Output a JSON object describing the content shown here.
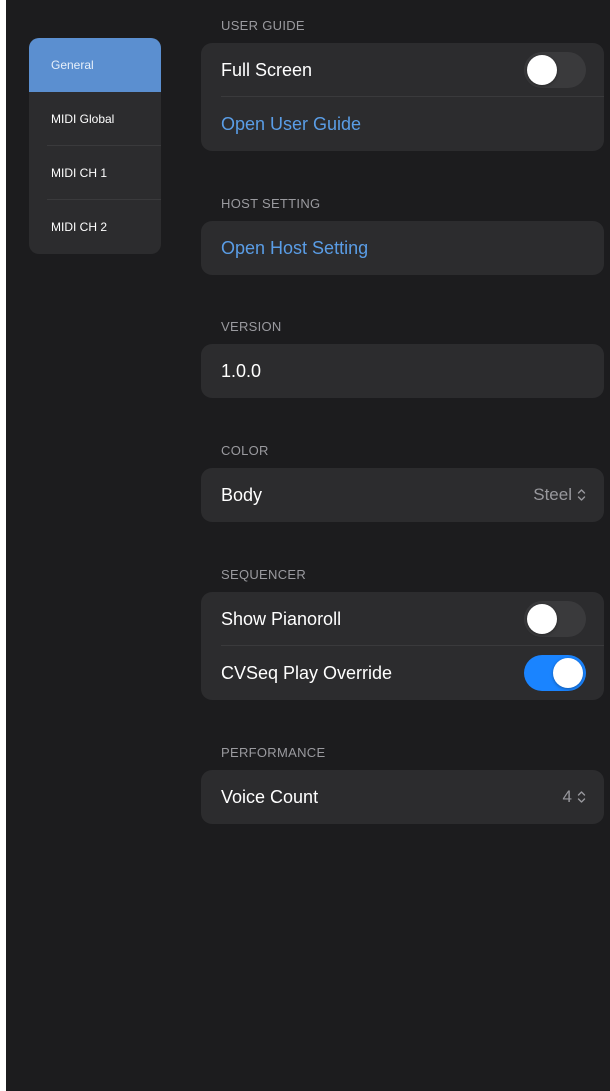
{
  "sidebar": {
    "items": [
      {
        "label": "General",
        "selected": true
      },
      {
        "label": "MIDI Global",
        "selected": false
      },
      {
        "label": "MIDI CH 1",
        "selected": false
      },
      {
        "label": "MIDI CH 2",
        "selected": false
      }
    ]
  },
  "user_guide": {
    "header": "USER GUIDE",
    "full_screen_label": "Full Screen",
    "full_screen_on": false,
    "open_user_guide_label": "Open User Guide"
  },
  "host_setting": {
    "header": "HOST SETTING",
    "open_host_setting_label": "Open Host Setting"
  },
  "version": {
    "header": "VERSION",
    "value": "1.0.0"
  },
  "color": {
    "header": "COLOR",
    "body_label": "Body",
    "body_value": "Steel"
  },
  "sequencer": {
    "header": "SEQUENCER",
    "show_pianoroll_label": "Show Pianoroll",
    "show_pianoroll_on": false,
    "cvseq_label": "CVSeq Play Override",
    "cvseq_on": true
  },
  "performance": {
    "header": "PERFORMANCE",
    "voice_count_label": "Voice Count",
    "voice_count_value": "4"
  },
  "colors": {
    "background": "#1c1c1e",
    "card": "#2c2c2e",
    "accent_link": "#5a9de6",
    "sidebar_selected": "#5b8fd0",
    "toggle_on": "#1a84ff",
    "toggle_off": "#3a3a3c"
  }
}
